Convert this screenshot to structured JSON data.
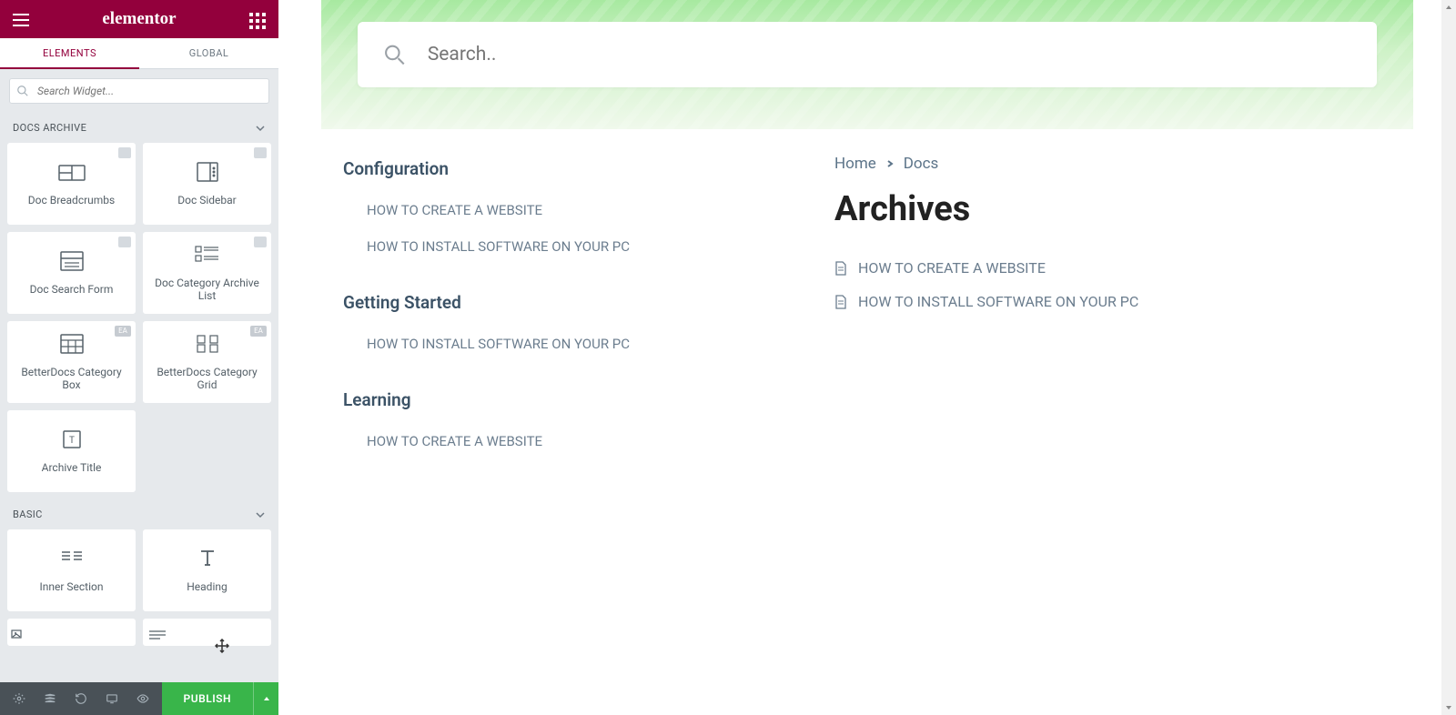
{
  "header": {
    "logo": "elementor"
  },
  "tabs": {
    "elements": "ELEMENTS",
    "global": "GLOBAL"
  },
  "search_widget_placeholder": "Search Widget...",
  "sections": {
    "docs_archive": "DOCS ARCHIVE",
    "basic": "BASIC"
  },
  "widgets": {
    "doc_breadcrumbs": "Doc Breadcrumbs",
    "doc_sidebar": "Doc Sidebar",
    "doc_search_form": "Doc Search Form",
    "doc_category_archive_list": "Doc Category Archive List",
    "betterdocs_category_box": "BetterDocs Category Box",
    "betterdocs_category_grid": "BetterDocs Category Grid",
    "archive_title": "Archive Title",
    "inner_section": "Inner Section",
    "heading": "Heading"
  },
  "badge_ea": "EA",
  "footer": {
    "publish": "PUBLISH"
  },
  "preview": {
    "search_placeholder": "Search..",
    "breadcrumb": {
      "home": "Home",
      "docs": "Docs"
    },
    "page_title": "Archives",
    "categories": [
      {
        "name": "Configuration",
        "links": [
          "HOW TO CREATE A WEBSITE",
          "HOW TO INSTALL SOFTWARE ON YOUR PC"
        ]
      },
      {
        "name": "Getting Started",
        "links": [
          "HOW TO INSTALL SOFTWARE ON YOUR PC"
        ]
      },
      {
        "name": "Learning",
        "links": [
          "HOW TO CREATE A WEBSITE"
        ]
      }
    ],
    "archives": [
      "HOW TO CREATE A WEBSITE",
      "HOW TO INSTALL SOFTWARE ON YOUR PC"
    ]
  }
}
